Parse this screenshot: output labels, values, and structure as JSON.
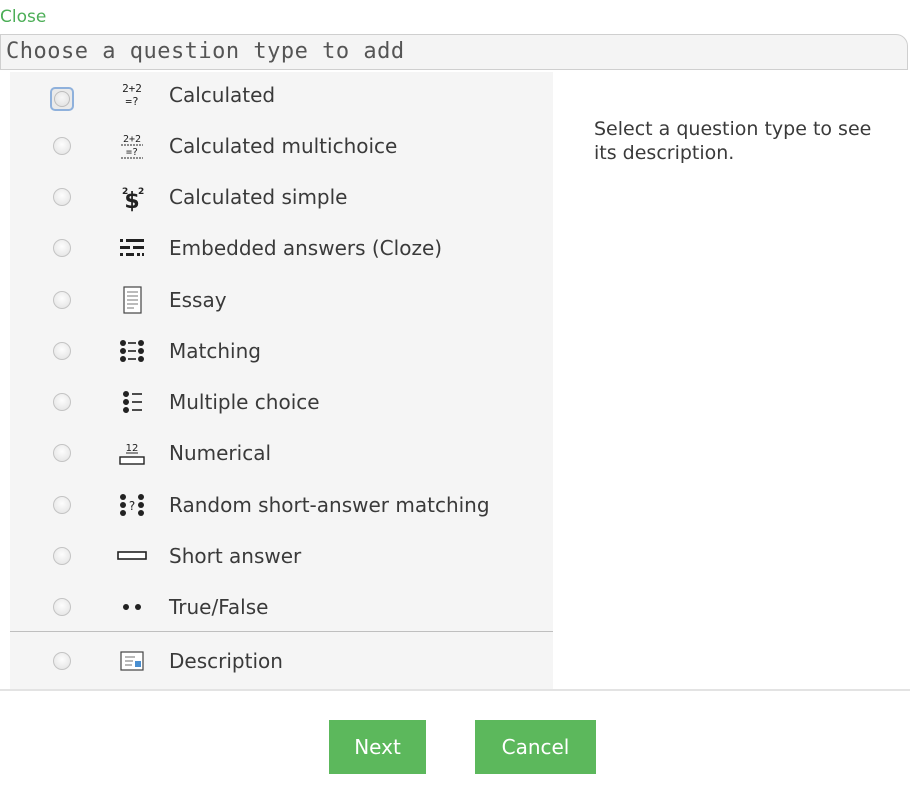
{
  "header": {
    "close_label": "Close",
    "title": "Choose a question type to add"
  },
  "question_types": [
    {
      "label": "Calculated",
      "icon": "calculated-icon"
    },
    {
      "label": "Calculated multichoice",
      "icon": "calculated-multichoice-icon"
    },
    {
      "label": "Calculated simple",
      "icon": "calculated-simple-icon"
    },
    {
      "label": "Embedded answers (Cloze)",
      "icon": "cloze-icon"
    },
    {
      "label": "Essay",
      "icon": "essay-icon"
    },
    {
      "label": "Matching",
      "icon": "matching-icon"
    },
    {
      "label": "Multiple choice",
      "icon": "multiple-choice-icon"
    },
    {
      "label": "Numerical",
      "icon": "numerical-icon"
    },
    {
      "label": "Random short-answer matching",
      "icon": "random-matching-icon"
    },
    {
      "label": "Short answer",
      "icon": "short-answer-icon"
    },
    {
      "label": "True/False",
      "icon": "true-false-icon"
    }
  ],
  "other_types": [
    {
      "label": "Description",
      "icon": "description-icon"
    }
  ],
  "description_panel": {
    "text": "Select a question type to see its description."
  },
  "footer": {
    "next_label": "Next",
    "cancel_label": "Cancel"
  },
  "colors": {
    "accent": "#5cb85c",
    "link": "#4cae57",
    "list_background": "#f5f5f5"
  }
}
